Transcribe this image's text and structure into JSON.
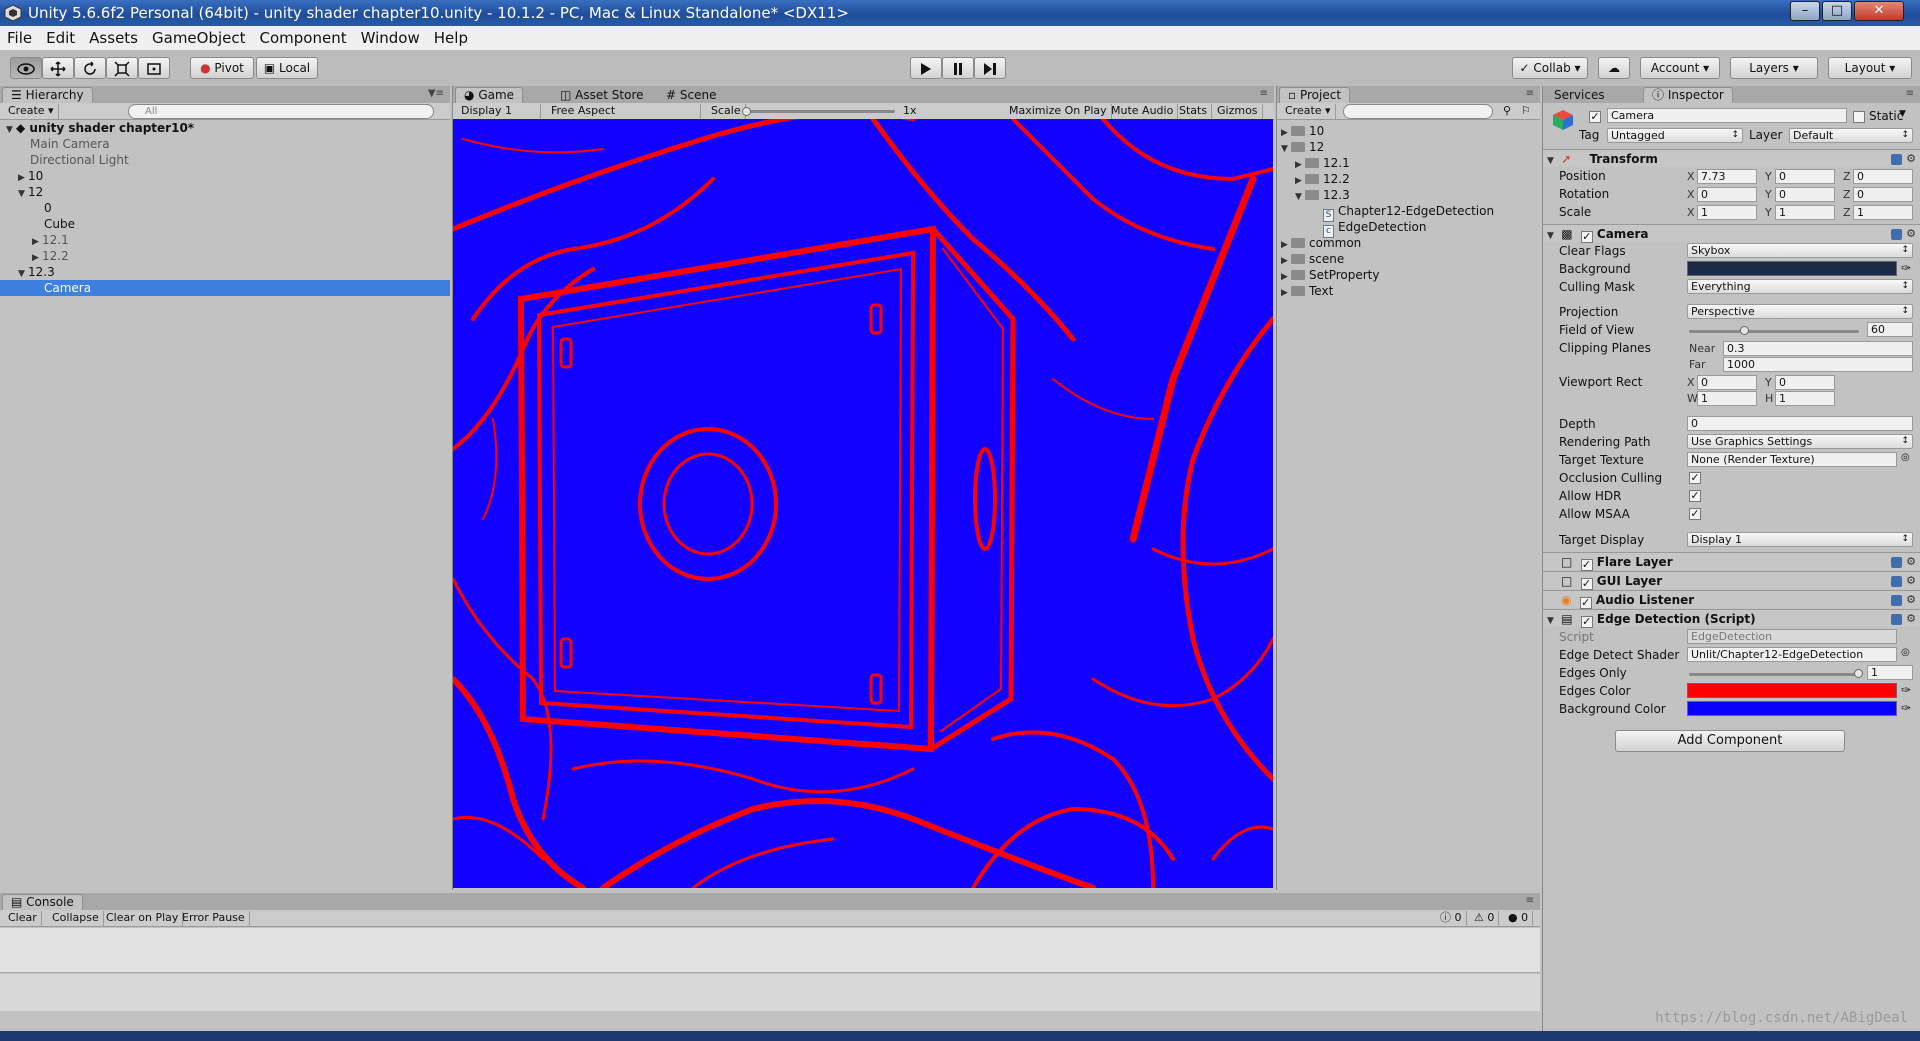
{
  "window": {
    "title": "Unity 5.6.6f2 Personal (64bit) - unity shader chapter10.unity - 10.1.2 - PC, Mac & Linux Standalone* <DX11>",
    "min_glyph": "–",
    "max_glyph": "□",
    "close_glyph": "✕"
  },
  "menu": [
    "File",
    "Edit",
    "Assets",
    "GameObject",
    "Component",
    "Window",
    "Help"
  ],
  "toolbar": {
    "pivot": "Pivot",
    "local": "Local",
    "collab": "Collab ▾",
    "account": "Account ▾",
    "layers": "Layers ▾",
    "layout": "Layout ▾"
  },
  "hierarchy": {
    "tab": "Hierarchy",
    "create": "Create ▾",
    "search_placeholder": "All",
    "scene": "unity shader chapter10*",
    "items": [
      {
        "label": "Main Camera"
      },
      {
        "label": "Directional Light"
      },
      {
        "label": "10"
      },
      {
        "label": "12"
      },
      {
        "label": "0"
      },
      {
        "label": "Cube"
      },
      {
        "label": "12.1"
      },
      {
        "label": "12.2"
      },
      {
        "label": "12.3"
      },
      {
        "label": "Camera"
      }
    ]
  },
  "game": {
    "tabs": [
      "Game",
      "Asset Store",
      "Scene"
    ],
    "display": "Display 1",
    "aspect": "Free Aspect",
    "scale_label": "Scale",
    "scale_value": "1x",
    "maximize": "Maximize On Play",
    "mute": "Mute Audio",
    "stats": "Stats",
    "gizmos": "Gizmos",
    "edge_color": "#ff0000",
    "background_color": "#1200ff"
  },
  "project": {
    "tab": "Project",
    "create": "Create ▾",
    "items": [
      {
        "label": "10"
      },
      {
        "label": "12"
      },
      {
        "label": "12.1"
      },
      {
        "label": "12.2"
      },
      {
        "label": "12.3"
      },
      {
        "label": "Chapter12-EdgeDetection"
      },
      {
        "label": "EdgeDetection"
      },
      {
        "label": "common"
      },
      {
        "label": "scene"
      },
      {
        "label": "SetProperty"
      },
      {
        "label": "Text"
      }
    ]
  },
  "inspector": {
    "tabs": [
      "Services",
      "Inspector"
    ],
    "object_name": "Camera",
    "static_label": "Static",
    "tag_label": "Tag",
    "tag_value": "Untagged",
    "layer_label": "Layer",
    "layer_value": "Default",
    "transform": {
      "title": "Transform",
      "position_label": "Position",
      "rotation_label": "Rotation",
      "scale_label": "Scale",
      "position": [
        "7.73",
        "0",
        "0"
      ],
      "rotation": [
        "0",
        "0",
        "0"
      ],
      "scale": [
        "1",
        "1",
        "1"
      ]
    },
    "camera": {
      "title": "Camera",
      "clear_flags_label": "Clear Flags",
      "clear_flags": "Skybox",
      "background_label": "Background",
      "background_color": "#1c2a4a",
      "culling_label": "Culling Mask",
      "culling": "Everything",
      "projection_label": "Projection",
      "projection": "Perspective",
      "fov_label": "Field of View",
      "fov": "60",
      "fov_fraction": 0.33,
      "clipping_label": "Clipping Planes",
      "near_label": "Near",
      "near": "0.3",
      "far_label": "Far",
      "far": "1000",
      "viewport_label": "Viewport Rect",
      "vx": "0",
      "vy": "0",
      "vw": "1",
      "vh": "1",
      "depth_label": "Depth",
      "depth": "0",
      "rendering_label": "Rendering Path",
      "rendering": "Use Graphics Settings",
      "target_tex_label": "Target Texture",
      "target_tex": "None (Render Texture)",
      "occlusion_label": "Occlusion Culling",
      "hdr_label": "Allow HDR",
      "msaa_label": "Allow MSAA",
      "display_label": "Target Display",
      "display": "Display 1"
    },
    "flare": "Flare Layer",
    "gui": "GUI Layer",
    "audio": "Audio Listener",
    "edge": {
      "title": "Edge Detection (Script)",
      "script_label": "Script",
      "script": "EdgeDetection",
      "shader_label": "Edge Detect Shader",
      "shader": "Unlit/Chapter12-EdgeDetection",
      "edges_only_label": "Edges Only",
      "edges_only": "1",
      "edges_only_fraction": 1.0,
      "edges_color_label": "Edges Color",
      "edges_color": "#ff0000",
      "bg_color_label": "Background Color",
      "bg_color": "#0a00ff"
    },
    "add_component": "Add Component"
  },
  "console": {
    "tab": "Console",
    "clear": "Clear",
    "collapse": "Collapse",
    "clear_on_play": "Clear on Play",
    "error_pause": "Error Pause",
    "info_count": "0",
    "warn_count": "0",
    "error_count": "0"
  },
  "watermark": "https://blog.csdn.net/ABigDeal"
}
